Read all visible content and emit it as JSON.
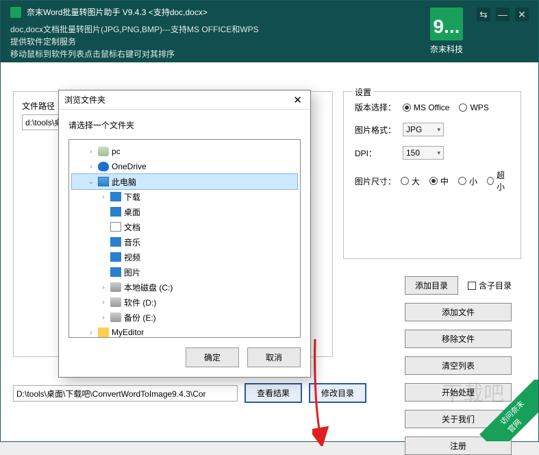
{
  "titlebar": {
    "title": "奈末Word批量转图片助手    V9.4.3  <支持doc,docx>",
    "desc1": "doc,docx文档批量转图片(JPG,PNG,BMP)---支持MS  OFFICE和WPS",
    "desc2": "提供软件定制服务",
    "desc3": "移动鼠标到软件列表点击鼠标右键可对其排序",
    "brand": "奈末科技"
  },
  "left": {
    "path_label": "文件路径",
    "path_value": "d:\\tools\\桌"
  },
  "settings": {
    "legend": "设置",
    "version_label": "版本选择：",
    "version_opts": [
      "MS Office",
      "WPS"
    ],
    "version_selected": 0,
    "format_label": "图片格式：",
    "format_value": "JPG",
    "dpi_label": "DPI：",
    "dpi_value": "150",
    "size_label": "图片尺寸：",
    "size_opts": [
      "大",
      "中",
      "小",
      "超小"
    ],
    "size_selected": 1
  },
  "buttons": {
    "add_dir": "添加目录",
    "include_sub": "含子目录",
    "add_file": "添加文件",
    "remove_file": "移除文件",
    "clear_list": "清空列表",
    "start": "开始处理",
    "about": "关于我们",
    "register": "注册"
  },
  "bottom": {
    "path": "D:\\tools\\桌面\\下载吧\\ConvertWordToImage9.4.3\\Cor",
    "view_result": "查看结果",
    "change_dir": "修改目录"
  },
  "dialog": {
    "title": "浏览文件夹",
    "prompt": "请选择一个文件夹",
    "ok": "确定",
    "cancel": "取消",
    "tree": [
      {
        "indent": 1,
        "expander": ">",
        "icon": "ic-user",
        "label": "pc"
      },
      {
        "indent": 1,
        "expander": ">",
        "icon": "ic-cloud",
        "label": "OneDrive"
      },
      {
        "indent": 1,
        "expander": "v",
        "icon": "ic-pc",
        "label": "此电脑",
        "sel": true
      },
      {
        "indent": 2,
        "expander": ">",
        "icon": "ic-dl",
        "label": "下载"
      },
      {
        "indent": 2,
        "expander": "",
        "icon": "ic-desk",
        "label": "桌面"
      },
      {
        "indent": 2,
        "expander": "",
        "icon": "ic-doc",
        "label": "文档"
      },
      {
        "indent": 2,
        "expander": "",
        "icon": "ic-music",
        "label": "音乐"
      },
      {
        "indent": 2,
        "expander": "",
        "icon": "ic-video",
        "label": "视频"
      },
      {
        "indent": 2,
        "expander": "",
        "icon": "ic-img",
        "label": "图片"
      },
      {
        "indent": 2,
        "expander": ">",
        "icon": "ic-disk",
        "label": "本地磁盘 (C:)"
      },
      {
        "indent": 2,
        "expander": ">",
        "icon": "ic-disk",
        "label": "软件 (D:)"
      },
      {
        "indent": 2,
        "expander": ">",
        "icon": "ic-disk",
        "label": "备份 (E:)"
      },
      {
        "indent": 1,
        "expander": ">",
        "icon": "ic-folder",
        "label": "MyEditor"
      }
    ]
  },
  "ribbon": "访问奈末官网",
  "watermark": "下载吧"
}
